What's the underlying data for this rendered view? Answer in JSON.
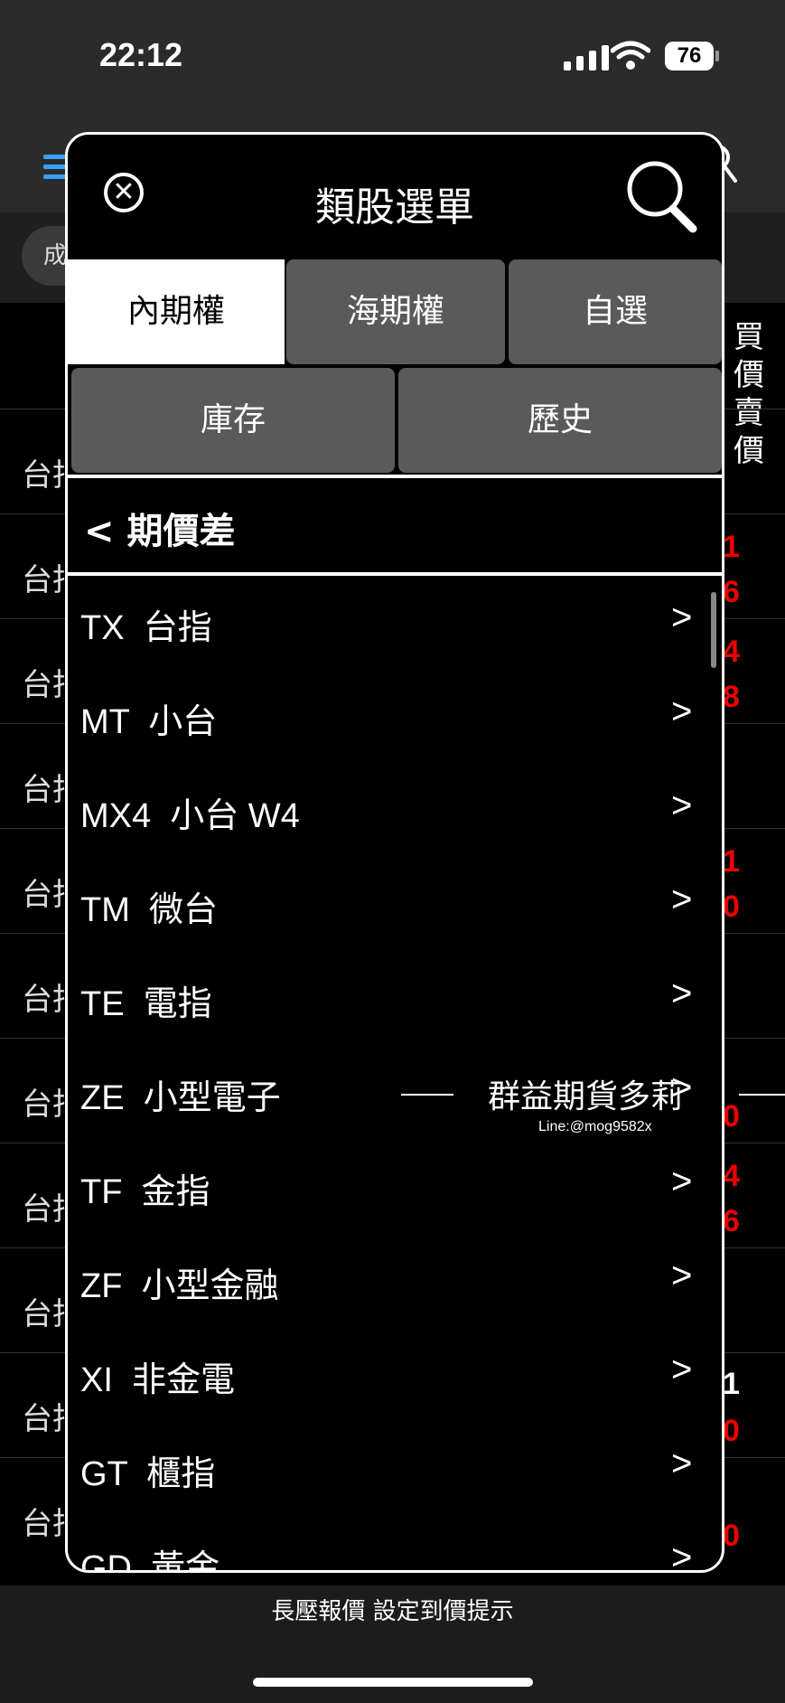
{
  "status_bar": {
    "time": "22:12",
    "battery": "76"
  },
  "background": {
    "filter_pill": "成",
    "column_header": [
      "買價",
      "賣價"
    ],
    "row_label": "台指",
    "red_values": [
      "1",
      "6",
      "4",
      "8",
      "1",
      "0",
      "0",
      "4",
      "6",
      "0",
      "0"
    ],
    "white_value": "1"
  },
  "modal": {
    "title": "類股選單",
    "tabs_row1": [
      "內期權",
      "海期權",
      "自選"
    ],
    "tabs_row2": [
      "庫存",
      "歷史"
    ],
    "section_title": "<  期價差",
    "items": [
      {
        "label": "TX  台指"
      },
      {
        "label": "MT  小台"
      },
      {
        "label": "MX4  小台 W4"
      },
      {
        "label": "TM  微台"
      },
      {
        "label": "TE  電指"
      },
      {
        "label": "ZE  小型電子"
      },
      {
        "label": "TF  金指"
      },
      {
        "label": "ZF  小型金融"
      },
      {
        "label": "XI  非金電"
      },
      {
        "label": "GT  櫃指"
      },
      {
        "label": "GD  黃金"
      }
    ],
    "chevron": ">"
  },
  "watermark": {
    "text": "群益期貨多莉",
    "subtext": "Line:@mog9582x"
  },
  "bottom_bar": {
    "text": "長壓報價 設定到價提示"
  }
}
